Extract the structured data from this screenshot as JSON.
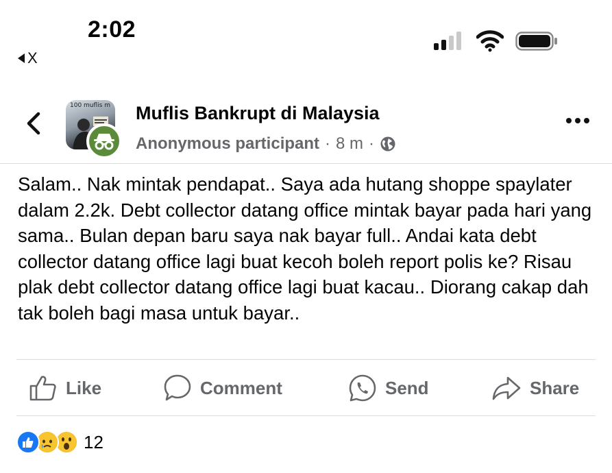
{
  "status_bar": {
    "time": "2:02",
    "back_app": "X",
    "signal_icon": "cellular-signal-icon",
    "wifi_icon": "wifi-icon",
    "battery_icon": "battery-icon"
  },
  "header": {
    "group_name": "Muflis Bankrupt di Malaysia",
    "author": "Anonymous participant",
    "separator": "·",
    "time_ago": "8 m",
    "avatar_text": "100 muflis m",
    "privacy_icon": "globe-icon"
  },
  "post": {
    "text": "Salam.. Nak mintak pendapat.. Saya ada hutang shoppe spaylater dalam 2.2k. Debt collector datang office mintak bayar pada hari yang sama.. Bulan depan baru saya nak bayar full.. Andai kata debt collector datang office lagi buat kecoh boleh report polis ke? Risau plak debt collector datang office lagi buat kacau.. Diorang cakap dah tak boleh bagi masa untuk bayar.."
  },
  "actions": {
    "like": "Like",
    "comment": "Comment",
    "send": "Send",
    "share": "Share"
  },
  "reactions": {
    "count": "12",
    "types": [
      "like",
      "sad",
      "wow"
    ]
  },
  "colors": {
    "secondary_text": "#65676b",
    "like_blue": "#1877f2",
    "anon_green": "#5a8a3a"
  }
}
